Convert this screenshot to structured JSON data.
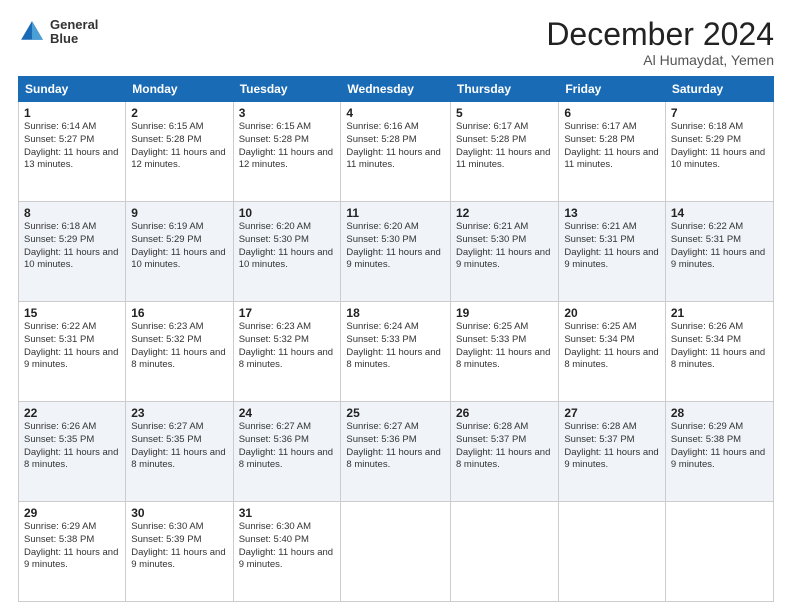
{
  "header": {
    "logo_line1": "General",
    "logo_line2": "Blue",
    "month_title": "December 2024",
    "location": "Al Humaydat, Yemen"
  },
  "weekdays": [
    "Sunday",
    "Monday",
    "Tuesday",
    "Wednesday",
    "Thursday",
    "Friday",
    "Saturday"
  ],
  "weeks": [
    [
      {
        "day": "1",
        "sunrise": "6:14 AM",
        "sunset": "5:27 PM",
        "daylight": "11 hours and 13 minutes."
      },
      {
        "day": "2",
        "sunrise": "6:15 AM",
        "sunset": "5:28 PM",
        "daylight": "11 hours and 12 minutes."
      },
      {
        "day": "3",
        "sunrise": "6:15 AM",
        "sunset": "5:28 PM",
        "daylight": "11 hours and 12 minutes."
      },
      {
        "day": "4",
        "sunrise": "6:16 AM",
        "sunset": "5:28 PM",
        "daylight": "11 hours and 11 minutes."
      },
      {
        "day": "5",
        "sunrise": "6:17 AM",
        "sunset": "5:28 PM",
        "daylight": "11 hours and 11 minutes."
      },
      {
        "day": "6",
        "sunrise": "6:17 AM",
        "sunset": "5:28 PM",
        "daylight": "11 hours and 11 minutes."
      },
      {
        "day": "7",
        "sunrise": "6:18 AM",
        "sunset": "5:29 PM",
        "daylight": "11 hours and 10 minutes."
      }
    ],
    [
      {
        "day": "8",
        "sunrise": "6:18 AM",
        "sunset": "5:29 PM",
        "daylight": "11 hours and 10 minutes."
      },
      {
        "day": "9",
        "sunrise": "6:19 AM",
        "sunset": "5:29 PM",
        "daylight": "11 hours and 10 minutes."
      },
      {
        "day": "10",
        "sunrise": "6:20 AM",
        "sunset": "5:30 PM",
        "daylight": "11 hours and 10 minutes."
      },
      {
        "day": "11",
        "sunrise": "6:20 AM",
        "sunset": "5:30 PM",
        "daylight": "11 hours and 9 minutes."
      },
      {
        "day": "12",
        "sunrise": "6:21 AM",
        "sunset": "5:30 PM",
        "daylight": "11 hours and 9 minutes."
      },
      {
        "day": "13",
        "sunrise": "6:21 AM",
        "sunset": "5:31 PM",
        "daylight": "11 hours and 9 minutes."
      },
      {
        "day": "14",
        "sunrise": "6:22 AM",
        "sunset": "5:31 PM",
        "daylight": "11 hours and 9 minutes."
      }
    ],
    [
      {
        "day": "15",
        "sunrise": "6:22 AM",
        "sunset": "5:31 PM",
        "daylight": "11 hours and 9 minutes."
      },
      {
        "day": "16",
        "sunrise": "6:23 AM",
        "sunset": "5:32 PM",
        "daylight": "11 hours and 8 minutes."
      },
      {
        "day": "17",
        "sunrise": "6:23 AM",
        "sunset": "5:32 PM",
        "daylight": "11 hours and 8 minutes."
      },
      {
        "day": "18",
        "sunrise": "6:24 AM",
        "sunset": "5:33 PM",
        "daylight": "11 hours and 8 minutes."
      },
      {
        "day": "19",
        "sunrise": "6:25 AM",
        "sunset": "5:33 PM",
        "daylight": "11 hours and 8 minutes."
      },
      {
        "day": "20",
        "sunrise": "6:25 AM",
        "sunset": "5:34 PM",
        "daylight": "11 hours and 8 minutes."
      },
      {
        "day": "21",
        "sunrise": "6:26 AM",
        "sunset": "5:34 PM",
        "daylight": "11 hours and 8 minutes."
      }
    ],
    [
      {
        "day": "22",
        "sunrise": "6:26 AM",
        "sunset": "5:35 PM",
        "daylight": "11 hours and 8 minutes."
      },
      {
        "day": "23",
        "sunrise": "6:27 AM",
        "sunset": "5:35 PM",
        "daylight": "11 hours and 8 minutes."
      },
      {
        "day": "24",
        "sunrise": "6:27 AM",
        "sunset": "5:36 PM",
        "daylight": "11 hours and 8 minutes."
      },
      {
        "day": "25",
        "sunrise": "6:27 AM",
        "sunset": "5:36 PM",
        "daylight": "11 hours and 8 minutes."
      },
      {
        "day": "26",
        "sunrise": "6:28 AM",
        "sunset": "5:37 PM",
        "daylight": "11 hours and 8 minutes."
      },
      {
        "day": "27",
        "sunrise": "6:28 AM",
        "sunset": "5:37 PM",
        "daylight": "11 hours and 9 minutes."
      },
      {
        "day": "28",
        "sunrise": "6:29 AM",
        "sunset": "5:38 PM",
        "daylight": "11 hours and 9 minutes."
      }
    ],
    [
      {
        "day": "29",
        "sunrise": "6:29 AM",
        "sunset": "5:38 PM",
        "daylight": "11 hours and 9 minutes."
      },
      {
        "day": "30",
        "sunrise": "6:30 AM",
        "sunset": "5:39 PM",
        "daylight": "11 hours and 9 minutes."
      },
      {
        "day": "31",
        "sunrise": "6:30 AM",
        "sunset": "5:40 PM",
        "daylight": "11 hours and 9 minutes."
      },
      null,
      null,
      null,
      null
    ]
  ],
  "labels": {
    "sunrise": "Sunrise: ",
    "sunset": "Sunset: ",
    "daylight": "Daylight: "
  }
}
